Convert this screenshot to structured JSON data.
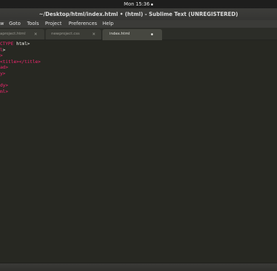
{
  "system_bar": {
    "clock": "Mon 15:36"
  },
  "window": {
    "title": "~/Desktop/html/index.html • (html) - Sublime Text (UNREGISTERED)"
  },
  "menu": {
    "items": [
      "w",
      "Goto",
      "Tools",
      "Project",
      "Preferences",
      "Help"
    ]
  },
  "tabs": [
    {
      "label": "aproject.html",
      "active": false
    },
    {
      "label": "newproject.css",
      "active": false
    },
    {
      "label": "index.html",
      "active": true
    }
  ],
  "editor": {
    "lines": [
      {
        "tag": "CTYPE",
        "rest": " html>"
      },
      {
        "tag": "l",
        "rest": ">"
      },
      {
        "tag": "",
        "rest": ">"
      },
      {
        "tag": "<title",
        "rest": "></title>"
      },
      {
        "tag": "ad",
        "rest": ">"
      },
      {
        "tag": "y",
        "rest": ">"
      },
      {
        "tag": "",
        "rest": ""
      },
      {
        "tag": "",
        "rest": ""
      },
      {
        "tag": "dy",
        "rest": ">"
      },
      {
        "tag": "ml",
        "rest": ">"
      }
    ]
  },
  "colors": {
    "editor_bg": "#272822",
    "tag": "#f92672",
    "text": "#f8f8f2"
  }
}
